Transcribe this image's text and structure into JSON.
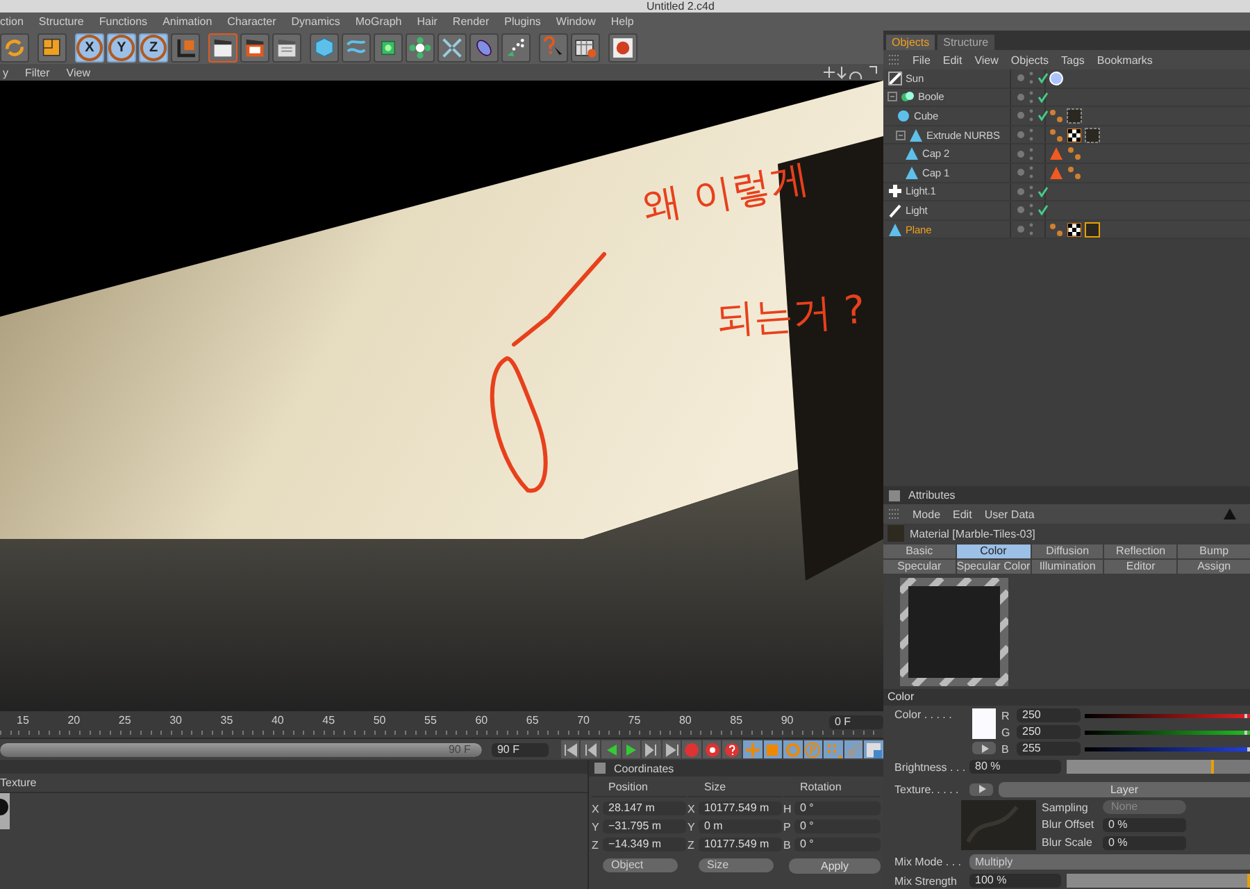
{
  "window": {
    "title": "Untitled 2.c4d"
  },
  "menu": [
    "ction",
    "Structure",
    "Functions",
    "Animation",
    "Character",
    "Dynamics",
    "MoGraph",
    "Hair",
    "Render",
    "Plugins",
    "Window",
    "Help"
  ],
  "toolbar": [
    [
      {
        "kind": "cycle",
        "selected": false
      }
    ],
    [
      {
        "kind": "box",
        "selected": false
      }
    ],
    [
      {
        "kind": "axis",
        "label": "X",
        "selected": true
      },
      {
        "kind": "axis",
        "label": "Y",
        "selected": true
      },
      {
        "kind": "axis",
        "label": "Z",
        "selected": true
      },
      {
        "kind": "coords",
        "selected": false
      }
    ],
    [
      {
        "kind": "clapper",
        "selected": true
      },
      {
        "kind": "clapper-red",
        "selected": false
      },
      {
        "kind": "clapper-list",
        "selected": false
      }
    ],
    [
      {
        "kind": "cube",
        "selected": false
      },
      {
        "kind": "spline",
        "selected": false
      },
      {
        "kind": "nurbs",
        "selected": false
      },
      {
        "kind": "array",
        "selected": false
      },
      {
        "kind": "deformer",
        "selected": false
      },
      {
        "kind": "scene",
        "selected": false
      },
      {
        "kind": "particles",
        "selected": false
      }
    ],
    [
      {
        "kind": "help",
        "selected": false
      },
      {
        "kind": "table",
        "selected": false
      }
    ],
    [
      {
        "kind": "globe",
        "selected": false
      }
    ]
  ],
  "viewport": {
    "menu": [
      "y",
      "Filter",
      "View"
    ],
    "annotation": [
      "왜 이렇게",
      "되는거 ?"
    ]
  },
  "timeline": {
    "ticks": [
      "15",
      "20",
      "25",
      "30",
      "35",
      "40",
      "45",
      "50",
      "55",
      "60",
      "65",
      "70",
      "75",
      "80",
      "85",
      "90"
    ],
    "current": "0 F",
    "range": {
      "label": "90 F",
      "level": 1
    },
    "end_field": "90 F"
  },
  "material_manager": {
    "header": "Texture"
  },
  "coordinates": {
    "title": "Coordinates",
    "columns": [
      "Position",
      "Size",
      "Rotation"
    ],
    "rows": [
      {
        "axis": "X",
        "position": "28.147 m",
        "size_axis": "X",
        "size": "10177.549 m",
        "rot_axis": "H",
        "rotation": "0 °"
      },
      {
        "axis": "Y",
        "position": "−31.795 m",
        "size_axis": "Y",
        "size": "0 m",
        "rot_axis": "P",
        "rotation": "0 °"
      },
      {
        "axis": "Z",
        "position": "−14.349 m",
        "size_axis": "Z",
        "size": "10177.549 m",
        "rot_axis": "B",
        "rotation": "0 °"
      }
    ],
    "dropdowns": [
      "Object",
      "Size"
    ],
    "apply": "Apply"
  },
  "objects": {
    "tabs": [
      {
        "label": "Objects",
        "selected": true
      },
      {
        "label": "Structure",
        "selected": false
      }
    ],
    "menu": [
      "File",
      "Edit",
      "View",
      "Objects",
      "Tags",
      "Bookmarks"
    ],
    "tree": [
      {
        "name": "Sun",
        "kind": "sun",
        "checked": true,
        "selected": false,
        "tags": [
          {
            "kind": "light-disc"
          }
        ]
      },
      {
        "name": "Boole",
        "kind": "boole",
        "checked": true,
        "selected": false,
        "children": [
          {
            "name": "Cube",
            "kind": "cube",
            "checked": true,
            "selected": false,
            "tags": [
              {
                "kind": "phong"
              },
              {
                "kind": "material"
              }
            ]
          },
          {
            "name": "Extrude NURBS",
            "kind": "nurbs",
            "checked": false,
            "selected": false,
            "tags": [
              {
                "kind": "phong"
              },
              {
                "kind": "checker"
              },
              {
                "kind": "material"
              }
            ],
            "children": [
              {
                "name": "Cap 2",
                "kind": "nurbs",
                "checked": false,
                "selected": false,
                "tags": [
                  {
                    "kind": "triangle"
                  },
                  {
                    "kind": "phong"
                  }
                ]
              },
              {
                "name": "Cap 1",
                "kind": "nurbs",
                "checked": false,
                "selected": false,
                "tags": [
                  {
                    "kind": "triangle"
                  },
                  {
                    "kind": "phong"
                  }
                ]
              }
            ]
          }
        ]
      },
      {
        "name": "Light.1",
        "kind": "light",
        "checked": true,
        "selected": false
      },
      {
        "name": "Light",
        "kind": "spot",
        "checked": true,
        "selected": false
      },
      {
        "name": "Plane",
        "kind": "nurbs",
        "checked": false,
        "selected": true,
        "tags": [
          {
            "kind": "phong"
          },
          {
            "kind": "checker"
          },
          {
            "kind": "material-active"
          }
        ]
      }
    ]
  },
  "attributes": {
    "title": "Attributes",
    "menu": [
      "Mode",
      "Edit",
      "User Data"
    ],
    "material": "Material [Marble-Tiles-03]",
    "tabs": [
      {
        "label": "Basic",
        "selected": false
      },
      {
        "label": "Color",
        "selected": true
      },
      {
        "label": "Diffusion",
        "selected": false
      },
      {
        "label": "Reflection",
        "selected": false
      },
      {
        "label": "Bump",
        "selected": false
      },
      {
        "label": "Specular",
        "selected": false
      },
      {
        "label": "Specular Color",
        "selected": false
      },
      {
        "label": "Illumination",
        "selected": false
      },
      {
        "label": "Editor",
        "selected": false
      },
      {
        "label": "Assign",
        "selected": false
      }
    ],
    "section": "Color",
    "color": {
      "label": "Color . . . . .",
      "channels": [
        {
          "name": "R",
          "value": "250",
          "level": 0.98
        },
        {
          "name": "G",
          "value": "250",
          "level": 0.98
        },
        {
          "name": "B",
          "value": "255",
          "level": 1
        }
      ]
    },
    "brightness": {
      "label": "Brightness . . .",
      "value": "80 %",
      "level": 0.8
    },
    "texture": {
      "label": "Texture. . . . .",
      "layer": "Layer",
      "sampling_label": "Sampling",
      "sampling": "None",
      "blur": [
        {
          "label": "Blur Offset",
          "value": "0 %"
        },
        {
          "label": "Blur Scale",
          "value": "0 %"
        }
      ]
    },
    "mix_mode": {
      "label": "Mix Mode . . .",
      "value": "Multiply"
    },
    "mix_strength": {
      "label": "Mix Strength",
      "value": "100 %",
      "level": 1
    }
  }
}
